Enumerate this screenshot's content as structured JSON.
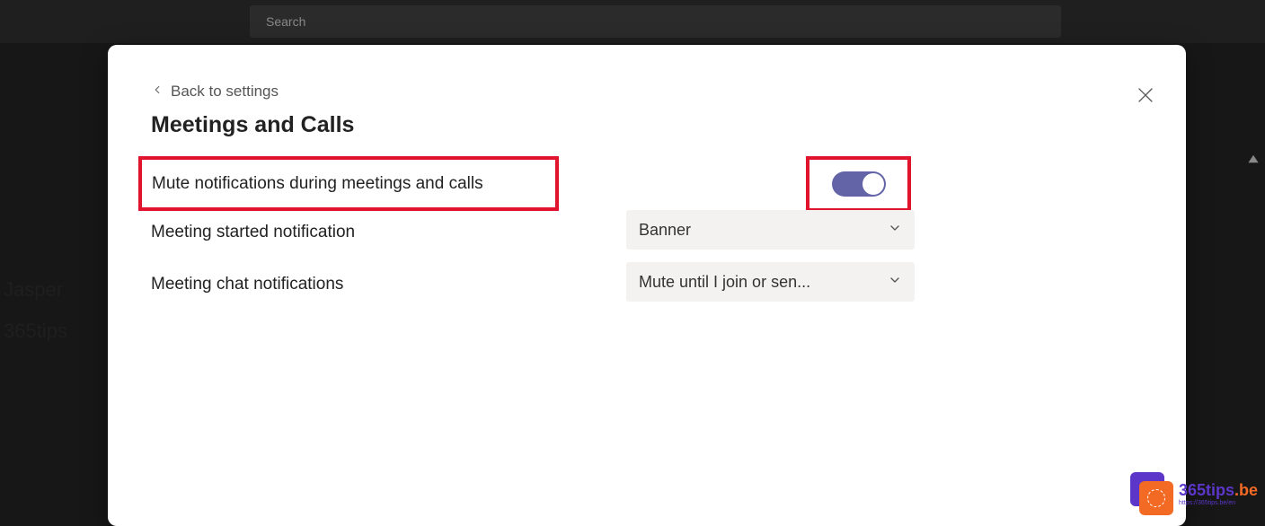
{
  "topbar": {
    "search_placeholder": "Search"
  },
  "background": {
    "line1": "Jasper",
    "line2": "365tips"
  },
  "modal": {
    "back_label": "Back to settings",
    "title": "Meetings and Calls",
    "close_label": "Close",
    "rows": {
      "mute": {
        "label": "Mute notifications during meetings and calls",
        "toggle_on": true
      },
      "started": {
        "label": "Meeting started notification",
        "value": "Banner"
      },
      "chat": {
        "label": "Meeting chat notifications",
        "value": "Mute until I join or sen..."
      }
    }
  },
  "watermark": {
    "brand": "365tips",
    "tld": ".be",
    "sub": "https://365tips.be/en"
  }
}
